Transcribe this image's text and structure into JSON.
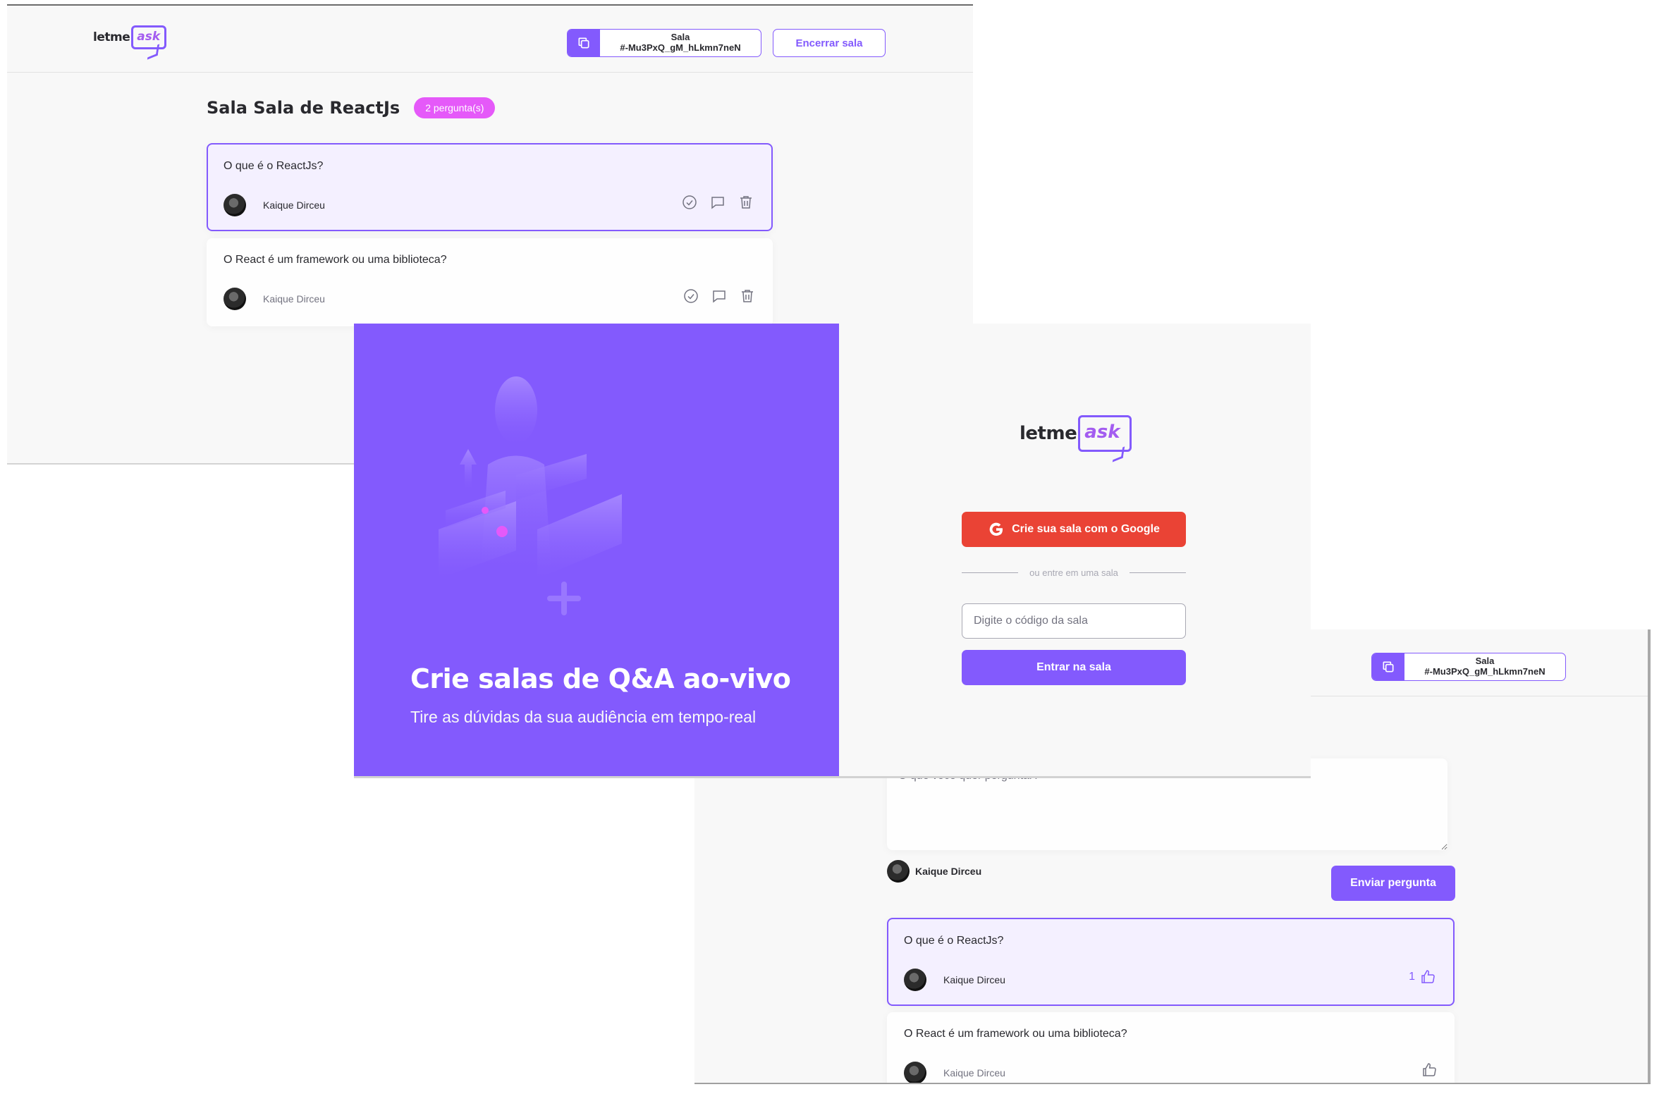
{
  "brand": {
    "logo_text": "letme",
    "logo_accent": "ask"
  },
  "colors": {
    "primary": "#835afd",
    "pink": "#e559f9",
    "google": "#ea4335",
    "background": "#f8f8f8"
  },
  "admin_room": {
    "room_code_label": "Sala",
    "room_code": "#-Mu3PxQ_gM_hLkmn7neN",
    "close_room_label": "Encerrar sala",
    "title": "Sala Sala de ReactJs",
    "question_count": "2 pergunta(s)",
    "questions": [
      {
        "content": "O que é o ReactJs?",
        "author": "Kaique Dirceu",
        "highlighted": true
      },
      {
        "content": "O React é um framework ou uma biblioteca?",
        "author": "Kaique Dirceu",
        "highlighted": false
      }
    ],
    "action_icons": [
      "check-circle-icon",
      "answer-icon",
      "trash-icon"
    ]
  },
  "home": {
    "aside_title": "Crie salas de Q&A ao-vivo",
    "aside_subtitle": "Tire as dúvidas da sua audiência em tempo-real",
    "google_button": "Crie sua sala com o Google",
    "separator": "ou entre em uma sala",
    "code_placeholder": "Digite o código da sala",
    "enter_button": "Entrar na sala"
  },
  "user_room": {
    "room_code_label": "Sala",
    "room_code": "#-Mu3PxQ_gM_hLkmn7neN",
    "textarea_placeholder": "O que você quer perguntar?",
    "user_name": "Kaique Dirceu",
    "send_button": "Enviar pergunta",
    "questions": [
      {
        "content": "O que é o ReactJs?",
        "author": "Kaique Dirceu",
        "likes": "1",
        "highlighted": true
      },
      {
        "content": "O React é um framework ou uma biblioteca?",
        "author": "Kaique Dirceu",
        "likes": "",
        "highlighted": false
      }
    ]
  }
}
